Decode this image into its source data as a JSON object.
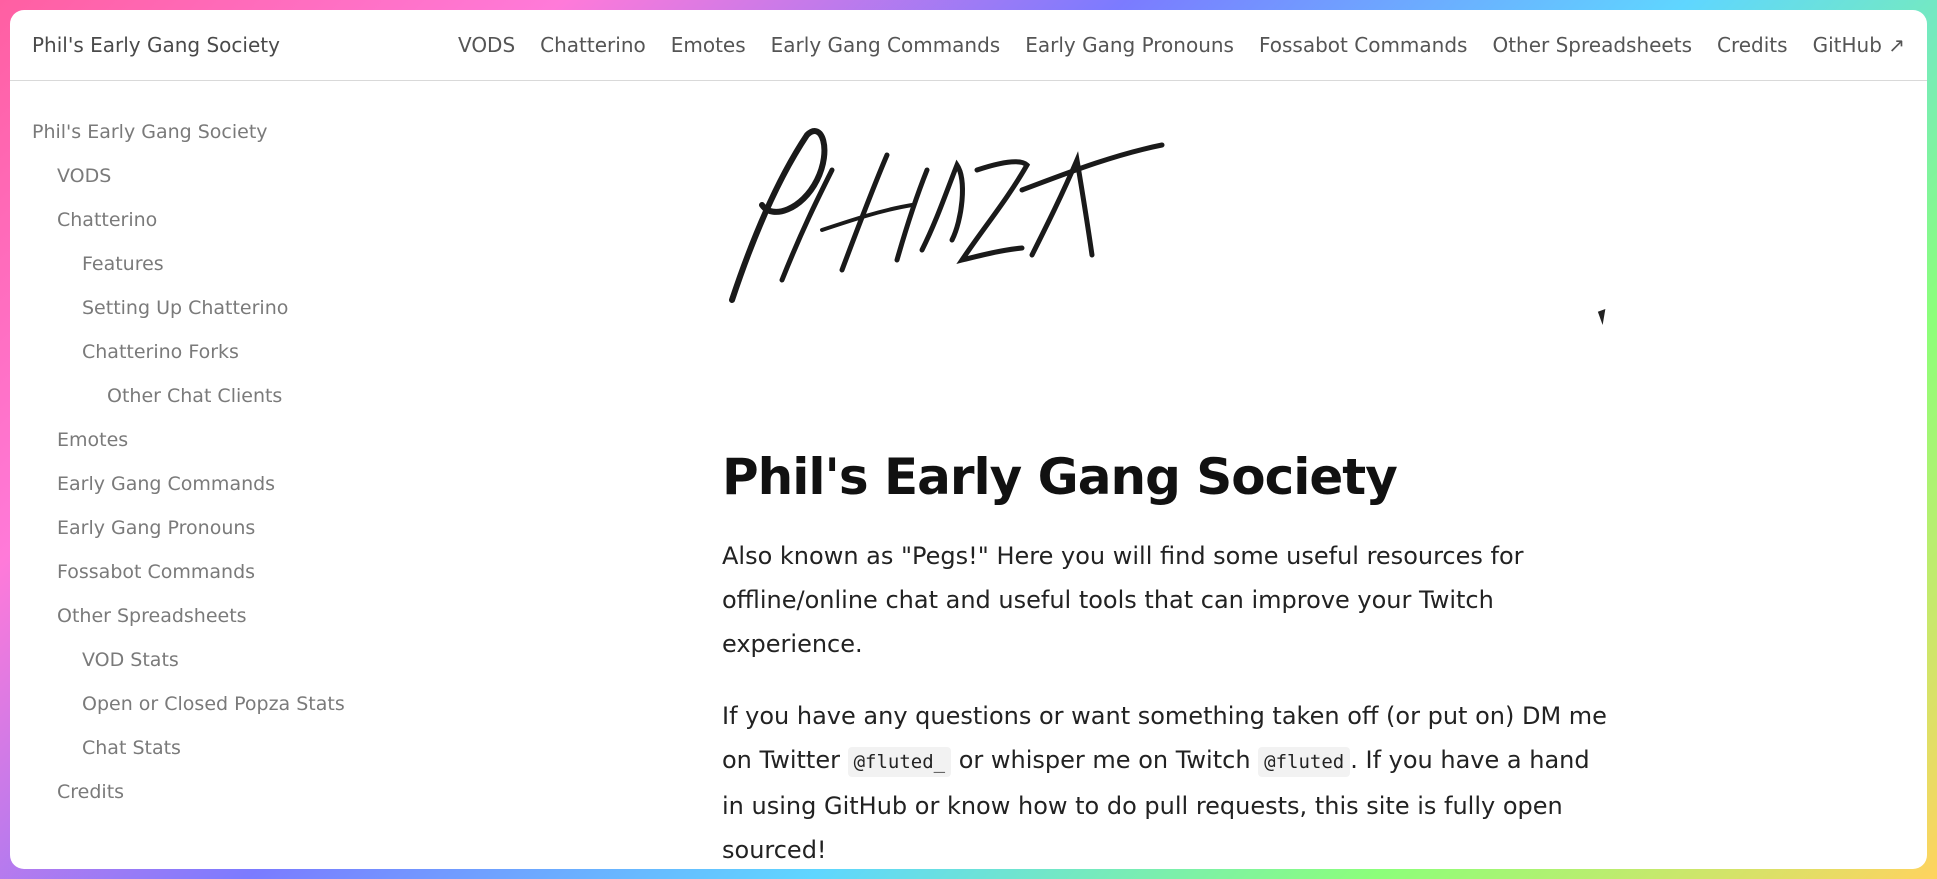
{
  "header": {
    "brand": "Phil's Early Gang Society",
    "nav": [
      "VODS",
      "Chatterino",
      "Emotes",
      "Early Gang Commands",
      "Early Gang Pronouns",
      "Fossabot Commands",
      "Other Spreadsheets",
      "Credits",
      "GitHub ↗"
    ]
  },
  "sidebar": {
    "items": [
      {
        "label": "Phil's Early Gang Society",
        "level": 0
      },
      {
        "label": "VODS",
        "level": 1
      },
      {
        "label": "Chatterino",
        "level": 1
      },
      {
        "label": "Features",
        "level": 2
      },
      {
        "label": "Setting Up Chatterino",
        "level": 2
      },
      {
        "label": "Chatterino Forks",
        "level": 2
      },
      {
        "label": "Other Chat Clients",
        "level": 3
      },
      {
        "label": "Emotes",
        "level": 1
      },
      {
        "label": "Early Gang Commands",
        "level": 1
      },
      {
        "label": "Early Gang Pronouns",
        "level": 1
      },
      {
        "label": "Fossabot Commands",
        "level": 1
      },
      {
        "label": "Other Spreadsheets",
        "level": 1
      },
      {
        "label": "VOD Stats",
        "level": 2
      },
      {
        "label": "Open or Closed Popza Stats",
        "level": 2
      },
      {
        "label": "Chat Stats",
        "level": 2
      },
      {
        "label": "Credits",
        "level": 1
      }
    ]
  },
  "main": {
    "logo_text": "PHILZA",
    "title": "Phil's Early Gang Society",
    "p1": "Also known as \"Pegs!\" Here you will find some useful resources for offline/online chat and useful tools that can improve your Twitch experience.",
    "p2_a": "If you have any questions or want something taken off (or put on) DM me on Twitter ",
    "p2_code1": "@fluted_",
    "p2_b": " or whisper me on Twitch ",
    "p2_code2": "@fluted",
    "p2_c": ". If you have a hand in using GitHub or know how to do pull requests, this site is fully open sourced!"
  }
}
